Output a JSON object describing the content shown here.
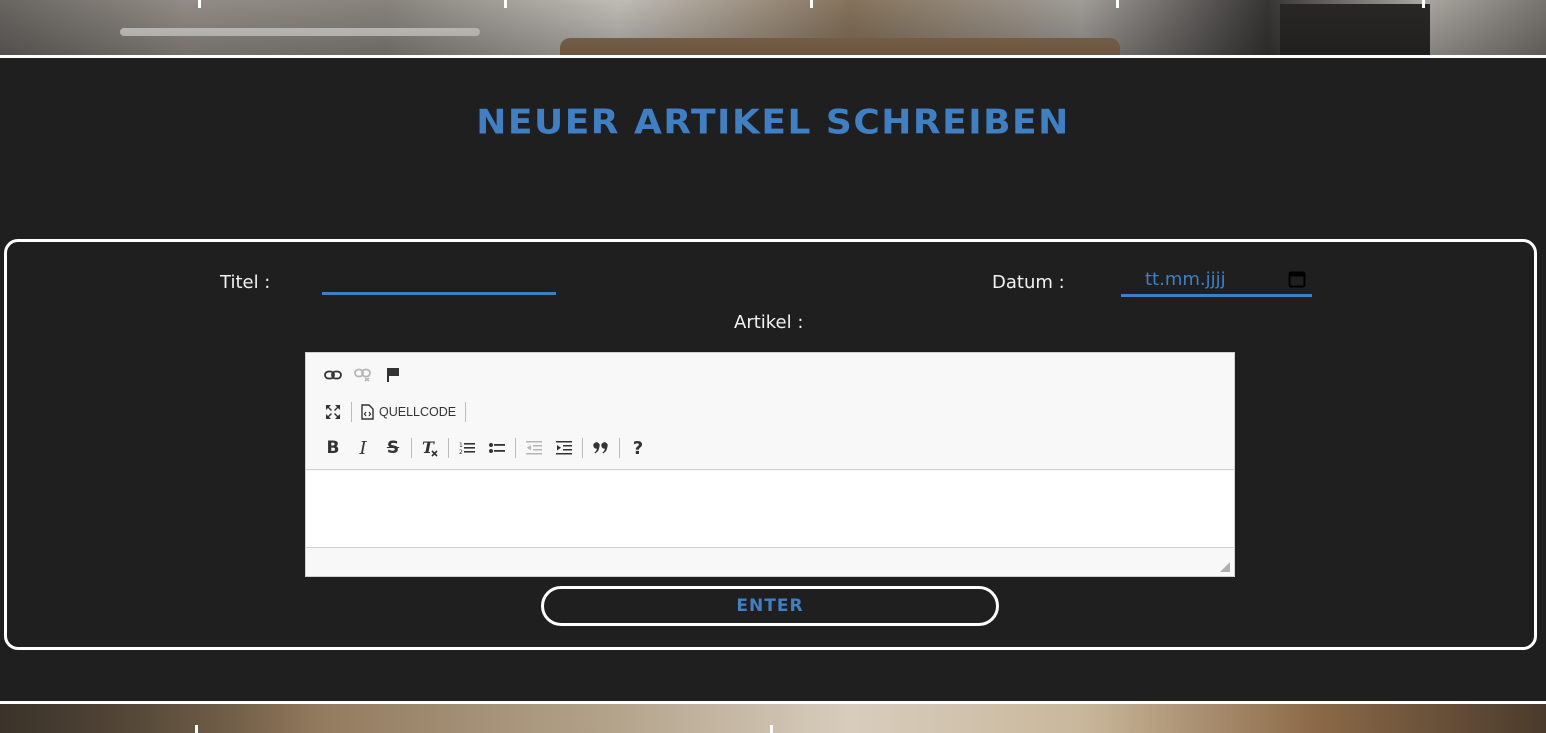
{
  "page": {
    "title": "NEUER ARTIKEL SCHREIBEN"
  },
  "form": {
    "title_label": "Titel :",
    "title_value": "",
    "date_label": "Datum :",
    "date_placeholder": "tt.mm.jjjj",
    "article_label": "Artikel :",
    "submit_label": "ENTER"
  },
  "editor": {
    "toolbar_row1": [
      {
        "icon": "link-icon",
        "enabled": true
      },
      {
        "icon": "unlink-icon",
        "enabled": false
      },
      {
        "icon": "flag-anchor-icon",
        "enabled": true
      }
    ],
    "toolbar_row2": [
      {
        "icon": "maximize-icon",
        "enabled": true
      },
      {
        "icon": "source-code-icon",
        "label": "QUELLCODE",
        "enabled": true
      }
    ],
    "toolbar_row3": [
      {
        "icon": "bold-icon",
        "glyph": "B",
        "enabled": true
      },
      {
        "icon": "italic-icon",
        "glyph": "I",
        "enabled": true
      },
      {
        "icon": "strikethrough-icon",
        "glyph": "S",
        "enabled": true
      },
      {
        "icon": "remove-format-icon",
        "glyph": "Tx",
        "enabled": true
      },
      {
        "icon": "numbered-list-icon",
        "enabled": true
      },
      {
        "icon": "bulleted-list-icon",
        "enabled": true
      },
      {
        "icon": "outdent-icon",
        "enabled": false
      },
      {
        "icon": "indent-icon",
        "enabled": true
      },
      {
        "icon": "blockquote-icon",
        "glyph": "99",
        "enabled": true
      },
      {
        "icon": "help-icon",
        "glyph": "?",
        "enabled": true
      }
    ],
    "content": ""
  },
  "colors": {
    "accent": "#3f7fc4",
    "background": "#201f20",
    "border": "#ffffff"
  }
}
